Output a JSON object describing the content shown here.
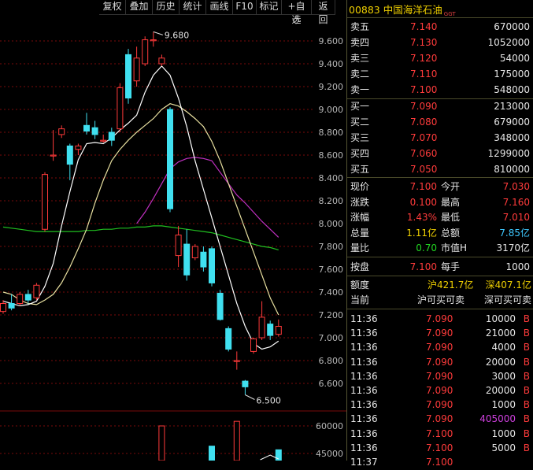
{
  "toolbar": [
    "复权",
    "叠加",
    "历史",
    "统计",
    "画线",
    "F10",
    "标记",
    "+自选",
    "返回"
  ],
  "stock": {
    "code": "00883",
    "name": "中国海洋石油",
    "tag": "GGT"
  },
  "asks": [
    {
      "label": "卖五",
      "price": "7.140",
      "vol": "670000"
    },
    {
      "label": "卖四",
      "price": "7.130",
      "vol": "1052000"
    },
    {
      "label": "卖三",
      "price": "7.120",
      "vol": "54000"
    },
    {
      "label": "卖二",
      "price": "7.110",
      "vol": "175000"
    },
    {
      "label": "卖一",
      "price": "7.100",
      "vol": "548000"
    }
  ],
  "bids": [
    {
      "label": "买一",
      "price": "7.090",
      "vol": "213000"
    },
    {
      "label": "买二",
      "price": "7.080",
      "vol": "679000"
    },
    {
      "label": "买三",
      "price": "7.070",
      "vol": "348000"
    },
    {
      "label": "买四",
      "price": "7.060",
      "vol": "1299000"
    },
    {
      "label": "买五",
      "price": "7.050",
      "vol": "810000"
    }
  ],
  "stats": {
    "now_l": "现价",
    "now": "7.100",
    "open_l": "今开",
    "open": "7.030",
    "chg_l": "涨跌",
    "chg": "0.100",
    "high_l": "最高",
    "high": "7.160",
    "pct_l": "涨幅",
    "pct": "1.43%",
    "low_l": "最低",
    "low": "7.010",
    "vol_l": "总量",
    "vol": "1.11亿",
    "amt_l": "总额",
    "amt": "7.85亿",
    "ratio_l": "量比",
    "ratio": "0.70",
    "mcap_l": "市值H",
    "mcap": "3170亿",
    "bp_l": "按盘",
    "bp": "7.100",
    "lot_l": "每手",
    "lot": "1000"
  },
  "quota": {
    "label": "额度",
    "sh": "沪421.7亿",
    "sz": "深407.1亿"
  },
  "current": {
    "label": "当前",
    "sh": "沪可买可卖",
    "sz": "深可买可卖"
  },
  "ticks": [
    {
      "t": "11:36",
      "p": "7.090",
      "v": "10000",
      "s": "B",
      "vc": "white"
    },
    {
      "t": "11:36",
      "p": "7.090",
      "v": "21000",
      "s": "B",
      "vc": "white"
    },
    {
      "t": "11:36",
      "p": "7.090",
      "v": "4000",
      "s": "B",
      "vc": "white"
    },
    {
      "t": "11:36",
      "p": "7.090",
      "v": "20000",
      "s": "B",
      "vc": "white"
    },
    {
      "t": "11:36",
      "p": "7.090",
      "v": "3000",
      "s": "B",
      "vc": "white"
    },
    {
      "t": "11:36",
      "p": "7.090",
      "v": "20000",
      "s": "B",
      "vc": "white"
    },
    {
      "t": "11:36",
      "p": "7.090",
      "v": "1000",
      "s": "B",
      "vc": "white"
    },
    {
      "t": "11:36",
      "p": "7.090",
      "v": "405000",
      "s": "B",
      "vc": "magenta"
    },
    {
      "t": "11:36",
      "p": "7.100",
      "v": "1000",
      "s": "B",
      "vc": "white"
    },
    {
      "t": "11:36",
      "p": "7.100",
      "v": "5000",
      "s": "B",
      "vc": "white"
    },
    {
      "t": "11:37",
      "p": "7.100",
      "v": "",
      "s": "",
      "vc": "white"
    }
  ],
  "chart": {
    "y_ticks": [
      "9.600",
      "9.400",
      "9.200",
      "9.000",
      "8.800",
      "8.600",
      "8.400",
      "8.200",
      "8.000",
      "7.800",
      "7.600",
      "7.400",
      "7.200",
      "7.000",
      "6.800",
      "6.600"
    ],
    "vol_ticks": [
      "60000",
      "45000"
    ],
    "max_label": "9.680",
    "min_label": "6.500",
    "candles": [
      {
        "o": 7.23,
        "c": 7.3,
        "h": 7.33,
        "l": 7.21
      },
      {
        "o": 7.3,
        "c": 7.26,
        "h": 7.38,
        "l": 7.24
      },
      {
        "o": 7.3,
        "c": 7.38,
        "h": 7.4,
        "l": 7.28
      },
      {
        "o": 7.38,
        "c": 7.33,
        "h": 7.42,
        "l": 7.3
      },
      {
        "o": 7.35,
        "c": 7.46,
        "h": 7.48,
        "l": 7.33
      },
      {
        "o": 7.95,
        "c": 8.43,
        "h": 8.45,
        "l": 7.93
      },
      {
        "o": 8.6,
        "c": 8.6,
        "h": 8.82,
        "l": 8.55
      },
      {
        "o": 8.78,
        "c": 8.83,
        "h": 8.86,
        "l": 8.75
      },
      {
        "o": 8.68,
        "c": 8.52,
        "h": 8.7,
        "l": 8.38
      },
      {
        "o": 8.65,
        "c": 8.68,
        "h": 8.7,
        "l": 8.6
      },
      {
        "o": 8.86,
        "c": 8.81,
        "h": 8.97,
        "l": 8.78
      },
      {
        "o": 8.84,
        "c": 8.78,
        "h": 8.9,
        "l": 8.74
      },
      {
        "o": 8.73,
        "c": 8.73,
        "h": 8.78,
        "l": 8.71
      },
      {
        "o": 8.8,
        "c": 8.73,
        "h": 8.84,
        "l": 8.68
      },
      {
        "o": 8.83,
        "c": 9.19,
        "h": 9.23,
        "l": 8.8
      },
      {
        "o": 9.48,
        "c": 9.1,
        "h": 9.53,
        "l": 9.05
      },
      {
        "o": 9.25,
        "c": 9.45,
        "h": 9.55,
        "l": 9.2
      },
      {
        "o": 9.4,
        "c": 9.61,
        "h": 9.64,
        "l": 9.38
      },
      {
        "o": 9.61,
        "c": 9.61,
        "h": 9.68,
        "l": 9.55
      },
      {
        "o": 9.4,
        "c": 9.45,
        "h": 9.48,
        "l": 9.38
      },
      {
        "o": 9.0,
        "c": 8.13,
        "h": 9.02,
        "l": 8.1
      },
      {
        "o": 7.72,
        "c": 7.9,
        "h": 7.98,
        "l": 7.62
      },
      {
        "o": 7.82,
        "c": 7.55,
        "h": 7.95,
        "l": 7.5
      },
      {
        "o": 7.7,
        "c": 7.8,
        "h": 7.82,
        "l": 7.68
      },
      {
        "o": 7.75,
        "c": 7.62,
        "h": 7.8,
        "l": 7.58
      },
      {
        "o": 7.78,
        "c": 7.48,
        "h": 7.8,
        "l": 7.45
      },
      {
        "o": 7.39,
        "c": 7.16,
        "h": 7.42,
        "l": 7.15
      },
      {
        "o": 7.08,
        "c": 6.9,
        "h": 7.1,
        "l": 6.88
      },
      {
        "o": 6.8,
        "c": 6.8,
        "h": 6.88,
        "l": 6.72
      },
      {
        "o": 6.62,
        "c": 6.57,
        "h": 6.63,
        "l": 6.5
      },
      {
        "o": 6.88,
        "c": 6.99,
        "h": 7.0,
        "l": 6.86
      },
      {
        "o": 7.0,
        "c": 7.18,
        "h": 7.32,
        "l": 6.98
      },
      {
        "o": 7.12,
        "c": 7.02,
        "h": 7.15,
        "l": 6.98
      },
      {
        "o": 7.03,
        "c": 7.1,
        "h": 7.16,
        "l": 7.01
      }
    ],
    "ma5": [
      7.32,
      7.3,
      7.28,
      7.29,
      7.32,
      7.45,
      7.65,
      7.98,
      8.28,
      8.56,
      8.7,
      8.71,
      8.7,
      8.75,
      8.82,
      8.88,
      8.95,
      9.15,
      9.3,
      9.38,
      9.3,
      9.1,
      8.85,
      8.55,
      8.3,
      8.05,
      7.8,
      7.55,
      7.3,
      7.1,
      6.95,
      6.9,
      6.92,
      6.97
    ],
    "ma10": [
      7.4,
      7.38,
      7.33,
      7.3,
      7.29,
      7.33,
      7.38,
      7.48,
      7.62,
      7.78,
      7.95,
      8.18,
      8.38,
      8.55,
      8.65,
      8.73,
      8.8,
      8.86,
      8.92,
      9.0,
      9.05,
      9.03,
      8.98,
      8.92,
      8.85,
      8.72,
      8.55,
      8.35,
      8.15,
      7.95,
      7.75,
      7.55,
      7.35,
      7.2
    ],
    "ma20": [
      null,
      null,
      null,
      null,
      null,
      null,
      null,
      null,
      null,
      null,
      null,
      null,
      null,
      null,
      null,
      null,
      8.0,
      8.1,
      8.22,
      8.35,
      8.48,
      8.54,
      8.57,
      8.58,
      8.57,
      8.55,
      8.45,
      8.35,
      8.25,
      8.18,
      8.1,
      8.02,
      7.95,
      7.88
    ],
    "ma60": [
      7.97,
      7.96,
      7.95,
      7.94,
      7.93,
      7.93,
      7.93,
      7.93,
      7.93,
      7.93,
      7.94,
      7.94,
      7.95,
      7.95,
      7.96,
      7.96,
      7.97,
      7.97,
      7.98,
      7.98,
      7.97,
      7.96,
      7.95,
      7.94,
      7.93,
      7.92,
      7.9,
      7.88,
      7.86,
      7.84,
      7.82,
      7.8,
      7.79,
      7.77
    ],
    "vol_bars": [
      {
        "i": 19,
        "v": 60000,
        "up": true
      },
      {
        "i": 25,
        "v": 49000,
        "up": false
      },
      {
        "i": 28,
        "v": 62500,
        "up": true
      },
      {
        "i": 33,
        "v": 47000,
        "up": false
      }
    ]
  }
}
